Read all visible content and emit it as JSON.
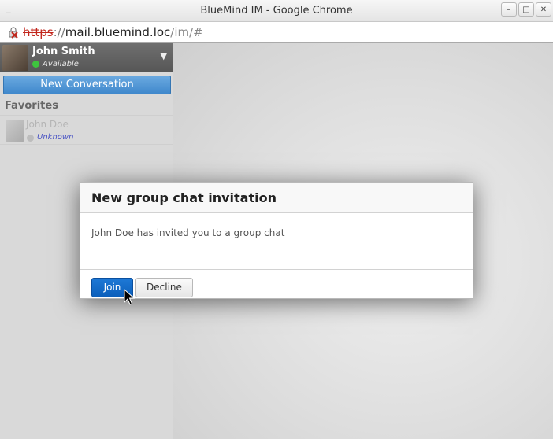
{
  "window": {
    "title": "BlueMind IM - Google Chrome",
    "buttons": [
      "–",
      "□",
      "✕"
    ]
  },
  "addressbar": {
    "scheme": "https",
    "separator": "://",
    "host": "mail.bluemind.loc",
    "path": "/im/#"
  },
  "user": {
    "name": "John Smith",
    "status": "Available",
    "status_color": "#3ec43e"
  },
  "sidebar": {
    "new_conversation_label": "New Conversation",
    "favorites_label": "Favorites",
    "contacts": [
      {
        "name": "John Doe",
        "status": "Unknown"
      }
    ]
  },
  "dialog": {
    "title": "New group chat invitation",
    "message": "John Doe has invited you to a group chat",
    "join_label": "Join",
    "decline_label": "Decline"
  },
  "colors": {
    "accent": "#3f88cc",
    "primary_button": "#0c5fbb",
    "broken_https": "#c2271d"
  }
}
